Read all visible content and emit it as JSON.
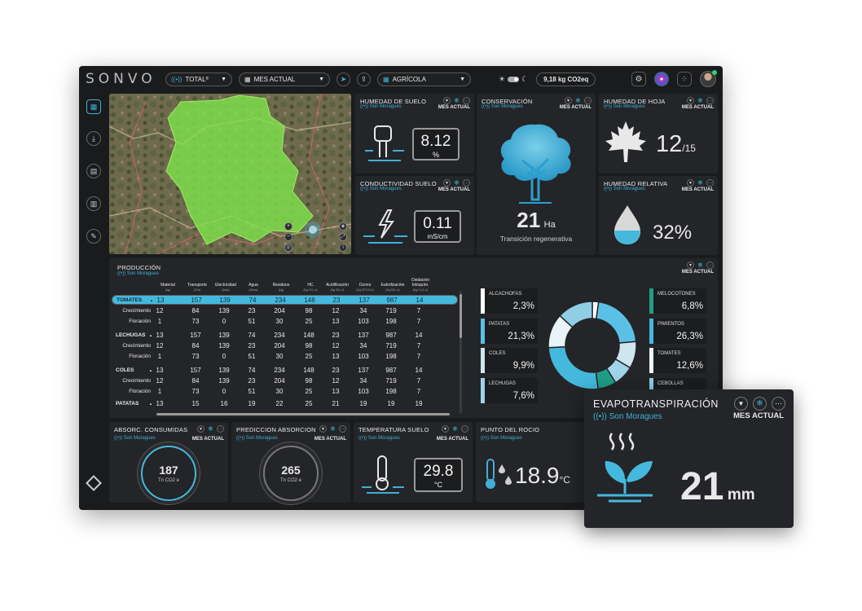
{
  "app": {
    "logo": "SONVO"
  },
  "topbar": {
    "scope": "TOTAL",
    "scope_sup": "®",
    "period": "MES ACTUAL",
    "sector": "AGRÍCOLA",
    "co2": "9,18 kg CO2eq"
  },
  "location": "Son Moraguez",
  "location_alt": "Son Moragues",
  "mes": "MES ACTUAL",
  "panels": {
    "humedad_suelo": {
      "title": "HUMEDAD DE SUELO",
      "location": "Son Moragues",
      "value": "8.12",
      "unit": "%"
    },
    "conductividad": {
      "title": "CONDUCTIVIDAD SUELO",
      "location": "Son Moragues",
      "value": "0.11",
      "unit": "mS/cm"
    },
    "conservacion": {
      "title": "CONSERVACIÓN",
      "location": "Son Moragues",
      "value": "21",
      "unit": "Ha",
      "caption": "Transición regenerativa"
    },
    "humedad_hoja": {
      "title": "HUMEDAD DE HOJA",
      "location": "Son Moragues",
      "value": "12",
      "suffix": "/15"
    },
    "humedad_relativa": {
      "title": "HUMEDAD RELATIVA",
      "location": "Son Moragues",
      "value": "32%"
    },
    "produccion": {
      "title": "PRODUCCIÓN",
      "location": "Son Moragues",
      "columns": [
        {
          "label": "Material",
          "unit": "(kg)"
        },
        {
          "label": "Transporte",
          "unit": "(Km)"
        },
        {
          "label": "Electricidad",
          "unit": "(Kwh)"
        },
        {
          "label": "Agua",
          "unit": "(Litros)"
        },
        {
          "label": "Residuos",
          "unit": "(kg)"
        },
        {
          "label": "HC",
          "unit": "(Kg CO₂ e)"
        },
        {
          "label": "Acidificación",
          "unit": "(Kg SO₂ e)"
        },
        {
          "label": "Ozono",
          "unit": "(Kg CFC11 e)"
        },
        {
          "label": "Eutrofización",
          "unit": "(Kg NO₃ e)"
        },
        {
          "label": "Oxidación fotoquím.",
          "unit": "(Kg C₂H₄ e)"
        }
      ],
      "rows": [
        {
          "name": "TOMATES",
          "group": true,
          "selected": true,
          "vals": [
            "13",
            "157",
            "139",
            "74",
            "234",
            "148",
            "23",
            "137",
            "987",
            "14"
          ]
        },
        {
          "name": "Crecimiento",
          "group": false,
          "vals": [
            "12",
            "84",
            "139",
            "23",
            "204",
            "98",
            "12",
            "34",
            "719",
            "7"
          ]
        },
        {
          "name": "Floración",
          "group": false,
          "vals": [
            "1",
            "73",
            "0",
            "51",
            "30",
            "25",
            "13",
            "103",
            "198",
            "7"
          ]
        },
        {
          "name": "LECHUGAS",
          "group": true,
          "vals": [
            "13",
            "157",
            "139",
            "74",
            "234",
            "148",
            "23",
            "137",
            "987",
            "14"
          ]
        },
        {
          "name": "Crecimiento",
          "group": false,
          "vals": [
            "12",
            "84",
            "139",
            "23",
            "204",
            "98",
            "12",
            "34",
            "719",
            "7"
          ]
        },
        {
          "name": "Floración",
          "group": false,
          "vals": [
            "1",
            "73",
            "0",
            "51",
            "30",
            "25",
            "13",
            "103",
            "198",
            "7"
          ]
        },
        {
          "name": "COLES",
          "group": true,
          "vals": [
            "13",
            "157",
            "139",
            "74",
            "234",
            "148",
            "23",
            "137",
            "987",
            "14"
          ]
        },
        {
          "name": "Crecimiento",
          "group": false,
          "vals": [
            "12",
            "84",
            "139",
            "23",
            "204",
            "98",
            "12",
            "34",
            "719",
            "7"
          ]
        },
        {
          "name": "Floración",
          "group": false,
          "vals": [
            "1",
            "73",
            "0",
            "51",
            "30",
            "25",
            "13",
            "103",
            "198",
            "7"
          ]
        },
        {
          "name": "PATATAS",
          "group": true,
          "vals": [
            "13",
            "15",
            "16",
            "19",
            "22",
            "25",
            "21",
            "19",
            "19",
            "19"
          ]
        }
      ]
    },
    "absorc": {
      "title": "ABSORC. CONSUMIDAS",
      "location": "Son Moragues",
      "value": "187",
      "unit": "Tn CO2 e"
    },
    "prediccion": {
      "title": "PREDICCION ABSORCION",
      "location": "Son Moragues",
      "value": "265",
      "unit": "Tn CO2 e"
    },
    "temperatura": {
      "title": "TEMPERATURA SUELO",
      "location": "Son Moragues",
      "value": "29.8",
      "unit": "°C"
    },
    "rocio": {
      "title": "PUNTO DEL ROCIO",
      "location": "Son Moragues",
      "value": "18.9",
      "unit": "°C"
    },
    "evapo": {
      "title": "EVAPOTRANSPIRACIÓN",
      "location": "Son Moragues",
      "value": "21",
      "unit": "mm"
    }
  },
  "legend_left": [
    {
      "name": "ALCACHOFAS",
      "value": "2,3%",
      "color": "#ffffff"
    },
    {
      "name": "PATATAS",
      "value": "21,3%",
      "color": "#5bc0e6"
    },
    {
      "name": "COLES",
      "value": "9,9%",
      "color": "#cfe6ef"
    },
    {
      "name": "LECHUGAS",
      "value": "7,6%",
      "color": "#9fd4ea"
    }
  ],
  "legend_right": [
    {
      "name": "MELOCOTONES",
      "value": "6,8%",
      "color": "#1f9e86"
    },
    {
      "name": "PIMIENTOS",
      "value": "26,3%",
      "color": "#45b8dd"
    },
    {
      "name": "TOMATES",
      "value": "12,6%",
      "color": "#e9f4f8"
    },
    {
      "name": "CEBOLLAS",
      "value": "",
      "color": "#8ecfe6"
    }
  ],
  "chart_data": {
    "type": "pie",
    "categories": [
      "ALCACHOFAS",
      "PATATAS",
      "COLES",
      "LECHUGAS",
      "MELOCOTONES",
      "PIMIENTOS",
      "TOMATES",
      "CEBOLLAS"
    ],
    "values": [
      2.3,
      21.3,
      9.9,
      7.6,
      6.8,
      26.3,
      12.6,
      13.2
    ],
    "colors": [
      "#ffffff",
      "#5bc0e6",
      "#cfe6ef",
      "#9fd4ea",
      "#1f9e86",
      "#45b8dd",
      "#e9f4f8",
      "#8ecfe6"
    ]
  }
}
